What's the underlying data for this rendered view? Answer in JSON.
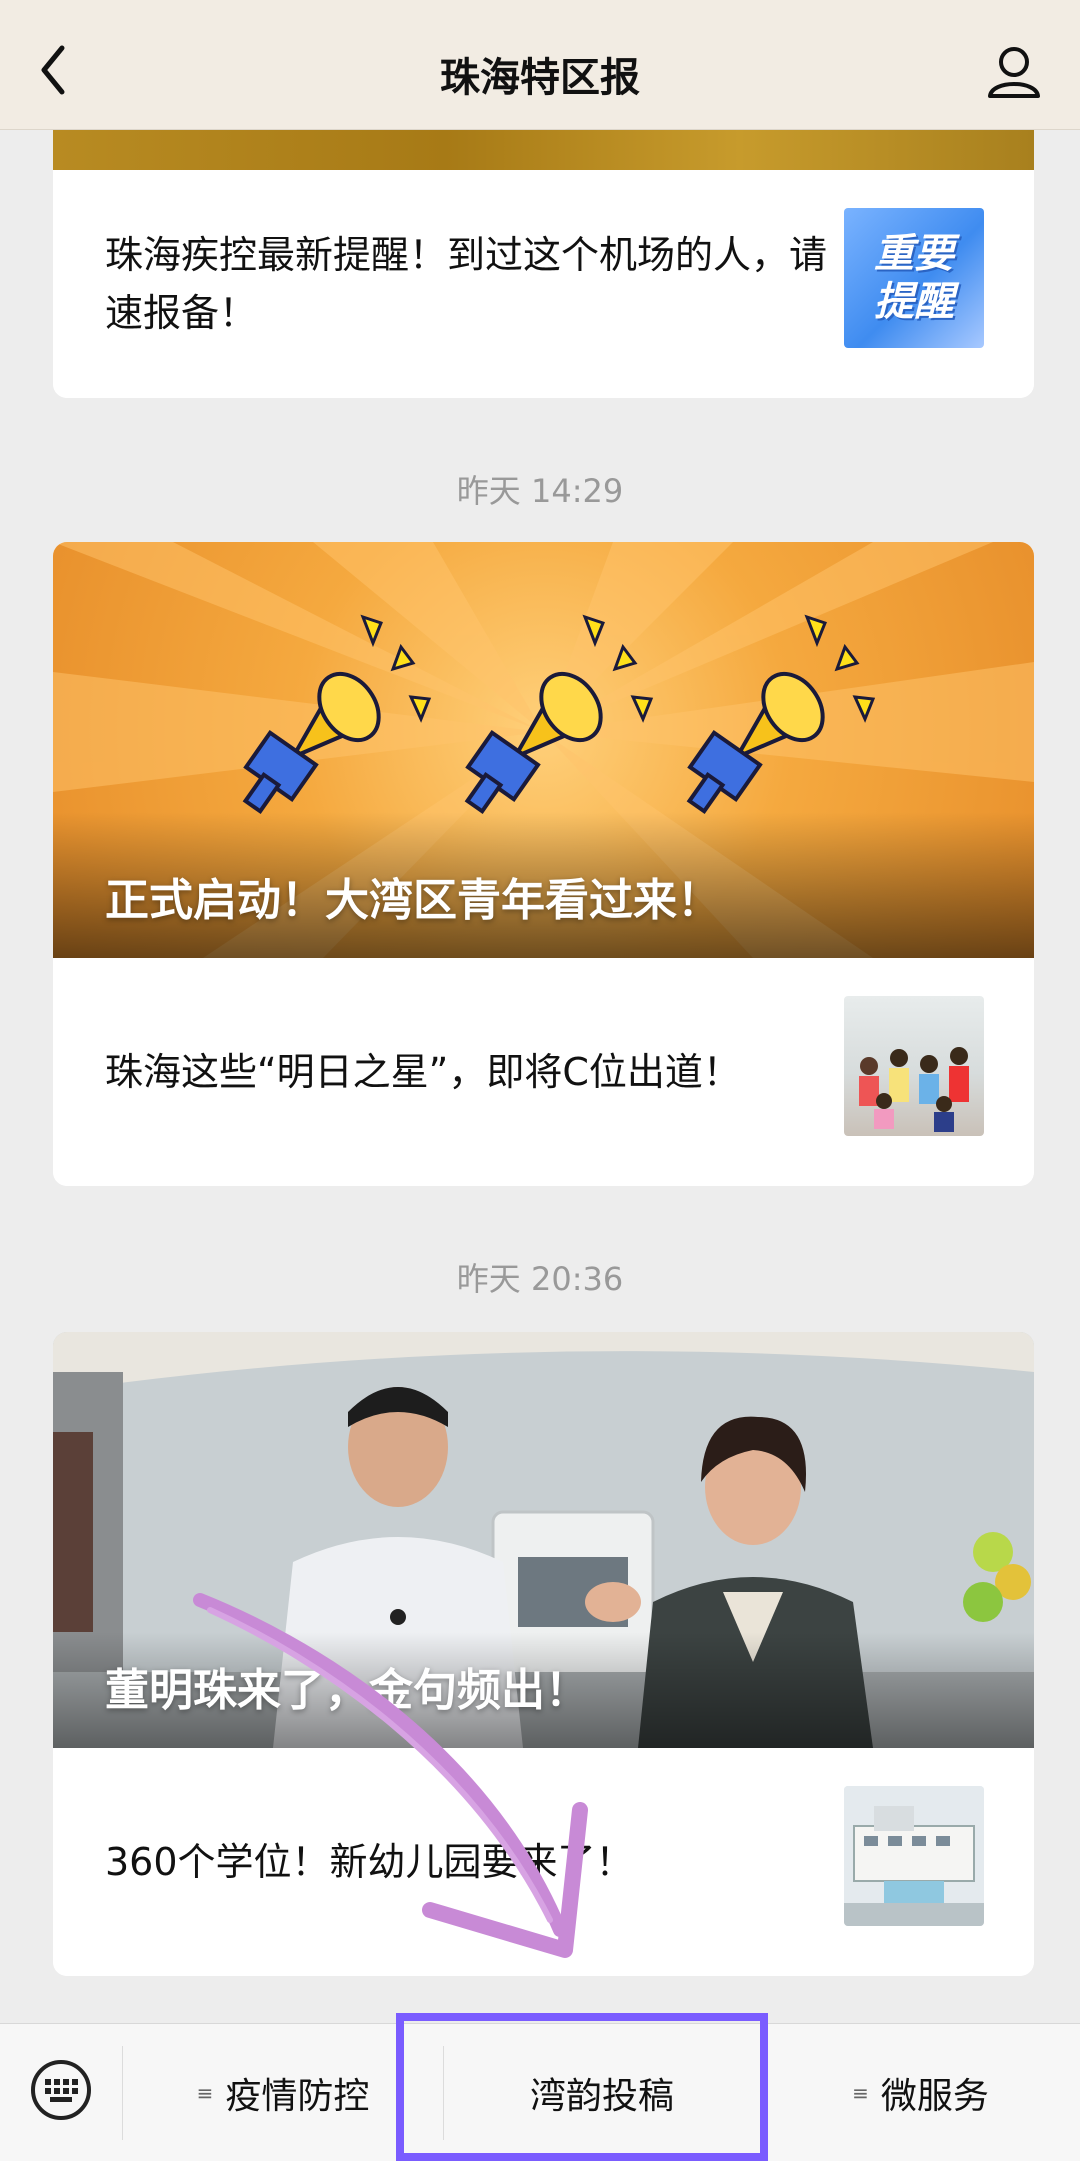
{
  "header": {
    "title": "珠海特区报"
  },
  "feed": {
    "item1": {
      "title": "珠海疾控最新提醒！到过这个机场的人，请速报备！",
      "thumb_text": "重要提醒"
    },
    "time2": "昨天 14:29",
    "item2": {
      "hero_caption": "正式启动！大湾区青年看过来！",
      "title": "珠海这些“明日之星”，即将C位出道！"
    },
    "time3": "昨天 20:36",
    "item3": {
      "hero_caption": "董明珠来了，金句频出！",
      "title": "360个学位！新幼儿园要来了！"
    }
  },
  "bottom_menu": {
    "items": [
      {
        "label": "疫情防控"
      },
      {
        "label": "湾韵投稿"
      },
      {
        "label": "微服务"
      }
    ]
  },
  "colors": {
    "nav_bg": "#f2ece3",
    "page_bg": "#ededed",
    "highlight": "#7a5cff",
    "annotation_arrow": "#c88ad6",
    "hero_orange": "#f0a13a"
  }
}
